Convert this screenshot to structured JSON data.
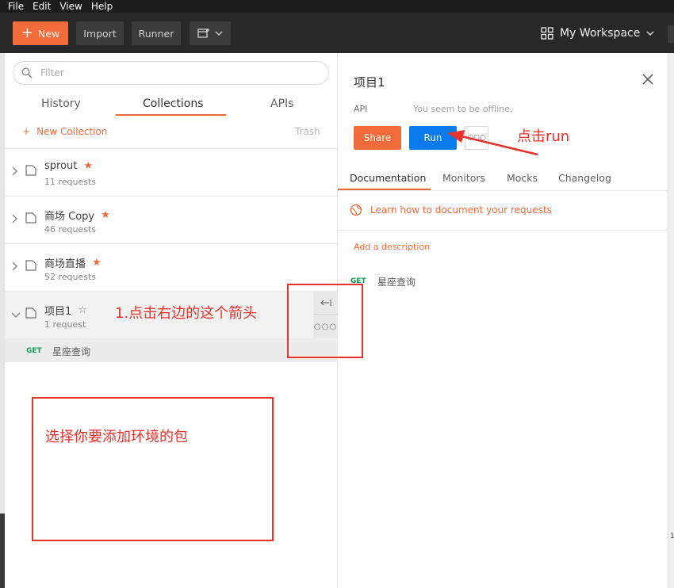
{
  "menu": [
    "File",
    "Edit",
    "View",
    "Help"
  ],
  "toolbar": {
    "new_label": "New",
    "import_label": "Import",
    "runner_label": "Runner",
    "workspace_label": "My Workspace"
  },
  "sidebar": {
    "filter_placeholder": "Filter",
    "tabs": [
      "History",
      "Collections",
      "APIs"
    ],
    "new_collection_label": "New Collection",
    "trash_label": "Trash",
    "collections": [
      {
        "name": "sprout",
        "count": "11 requests"
      },
      {
        "name": "商场 Copy",
        "count": "46 requests"
      },
      {
        "name": "商场直播",
        "count": "52 requests"
      },
      {
        "name": "项目1",
        "count": "1 request"
      }
    ],
    "request": {
      "method": "GET",
      "name": "星座查询"
    }
  },
  "panel": {
    "title": "项目1",
    "api_label": "API",
    "offline_text": "You seem to be offline.",
    "share_label": "Share",
    "run_label": "Run",
    "tabs": [
      "Documentation",
      "Monitors",
      "Mocks",
      "Changelog"
    ],
    "learn_link": "Learn how to document your requests",
    "add_description": "Add a description",
    "request": {
      "method": "GET",
      "name": "星座查询"
    }
  },
  "annotations": {
    "note_arrow_side": "1.点击右边的这个箭头",
    "note_select_package": "选择你要添加环境的包",
    "note_click_run": "点击run"
  },
  "colors": {
    "accent": "#f26b3a",
    "run_blue": "#097bed",
    "annotation_red": "#e8322e",
    "get_green": "#0f9d58"
  }
}
